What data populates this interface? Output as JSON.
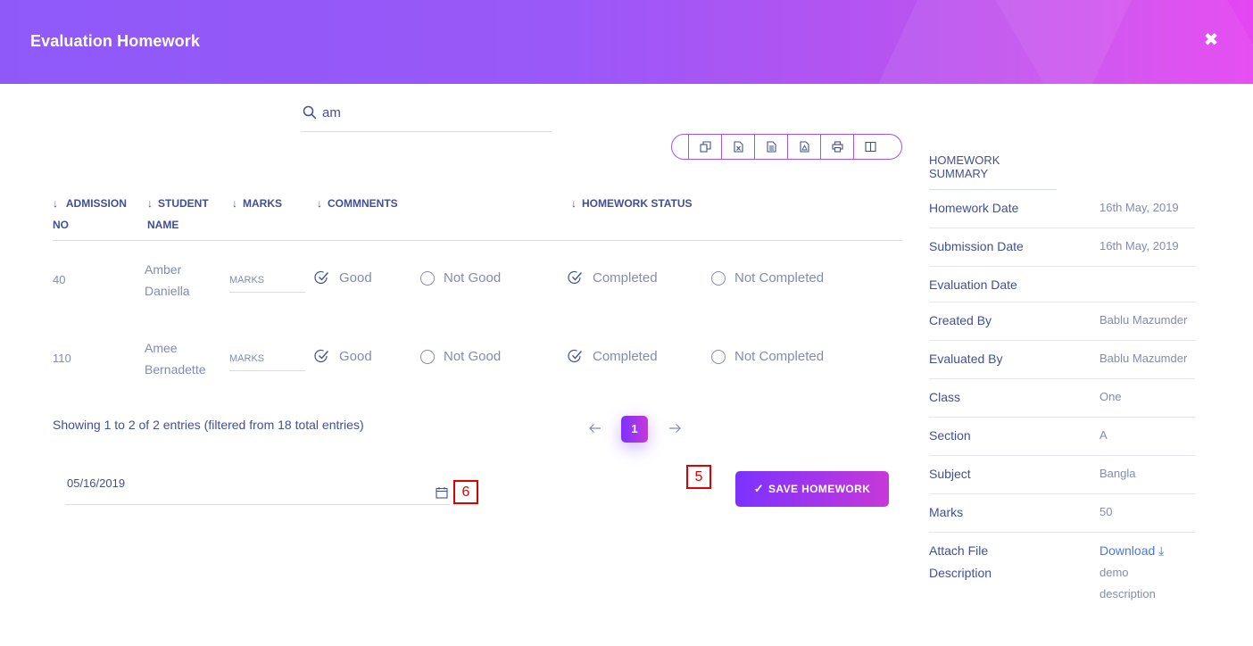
{
  "modal": {
    "title": "Evaluation Homework",
    "close_label": "✖"
  },
  "search": {
    "value": "am",
    "placeholder": ""
  },
  "export_buttons": [
    "copy-icon",
    "excel-icon",
    "csv-icon",
    "pdf-icon",
    "print-icon",
    "columns-icon"
  ],
  "table": {
    "headers": {
      "admission": "ADMISSION NO",
      "student": "STUDENT NAME",
      "marks": "MARKS",
      "comments": "COMMNENTS",
      "status": "HOMEWORK STATUS"
    },
    "rows": [
      {
        "admission_no": "40",
        "name": "Amber Daniella",
        "marks_placeholder": "MARKS",
        "comment_good": "Good",
        "comment_not_good": "Not Good",
        "status_completed": "Completed",
        "status_not_completed": "Not Completed"
      },
      {
        "admission_no": "110",
        "name": "Amee Bernadette",
        "marks_placeholder": "MARKS",
        "comment_good": "Good",
        "comment_not_good": "Not Good",
        "status_completed": "Completed",
        "status_not_completed": "Not Completed"
      }
    ]
  },
  "entries_info": "Showing 1 to 2 of 2 entries (filtered from 18 total entries)",
  "pagination": {
    "current": "1"
  },
  "evaluation_date": {
    "value": "05/16/2019"
  },
  "markers": {
    "six": "6",
    "five": "5"
  },
  "save_button": {
    "label": "SAVE HOMEWORK"
  },
  "summary": {
    "title": "HOMEWORK SUMMARY",
    "homework_date": {
      "label": "Homework Date",
      "value": "16th May, 2019"
    },
    "submission_date": {
      "label": "Submission Date",
      "value": "16th May, 2019"
    },
    "evaluation_date": {
      "label": "Evaluation Date",
      "value": ""
    },
    "created_by": {
      "label": "Created By",
      "value": "Bablu Mazumder"
    },
    "evaluated_by": {
      "label": "Evaluated By",
      "value": "Bablu Mazumder"
    },
    "class": {
      "label": "Class",
      "value": "One"
    },
    "section": {
      "label": "Section",
      "value": "A"
    },
    "subject": {
      "label": "Subject",
      "value": "Bangla"
    },
    "marks": {
      "label": "Marks",
      "value": "50"
    },
    "attach_file": {
      "label": "Attach File",
      "link": "Download"
    },
    "description": {
      "label": "Description",
      "value": "demo description"
    }
  },
  "colors": {
    "accent": "#7c32ff",
    "accent_end": "#c738d8",
    "text": "#415094",
    "muted": "#828bb2",
    "link": "#4a77e8",
    "marker": "#e00000"
  }
}
